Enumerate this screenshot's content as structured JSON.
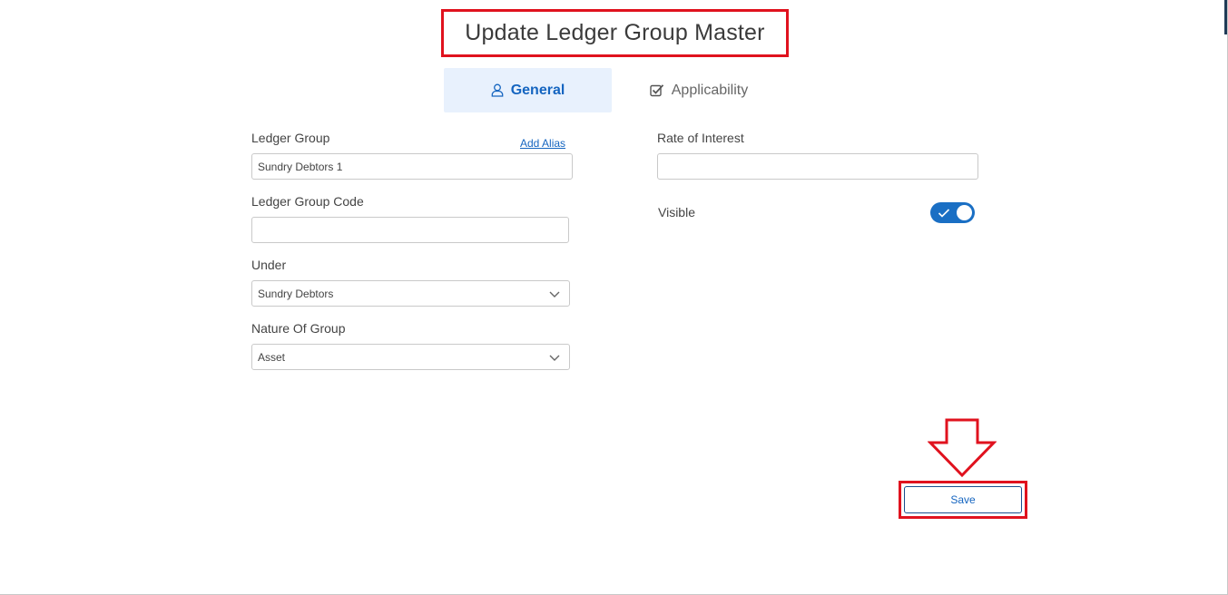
{
  "page": {
    "title": "Update Ledger Group Master"
  },
  "tabs": [
    {
      "label": "General",
      "icon": "user-icon",
      "active": true
    },
    {
      "label": "Applicability",
      "icon": "checkbox-icon",
      "active": false
    }
  ],
  "form": {
    "ledger_group": {
      "label": "Ledger Group",
      "value": "Sundry Debtors 1",
      "alias_link": "Add Alias"
    },
    "ledger_group_code": {
      "label": "Ledger Group Code",
      "value": ""
    },
    "under": {
      "label": "Under",
      "value": "Sundry Debtors"
    },
    "nature_of_group": {
      "label": "Nature Of Group",
      "value": "Asset"
    },
    "rate_of_interest": {
      "label": "Rate of Interest",
      "value": ""
    },
    "visible": {
      "label": "Visible",
      "on": true
    }
  },
  "actions": {
    "save_label": "Save"
  },
  "colors": {
    "accent": "#1565c0",
    "highlight": "#e0121e",
    "active_tab_bg": "#e8f1fd",
    "toggle_on": "#1a6fc4"
  }
}
